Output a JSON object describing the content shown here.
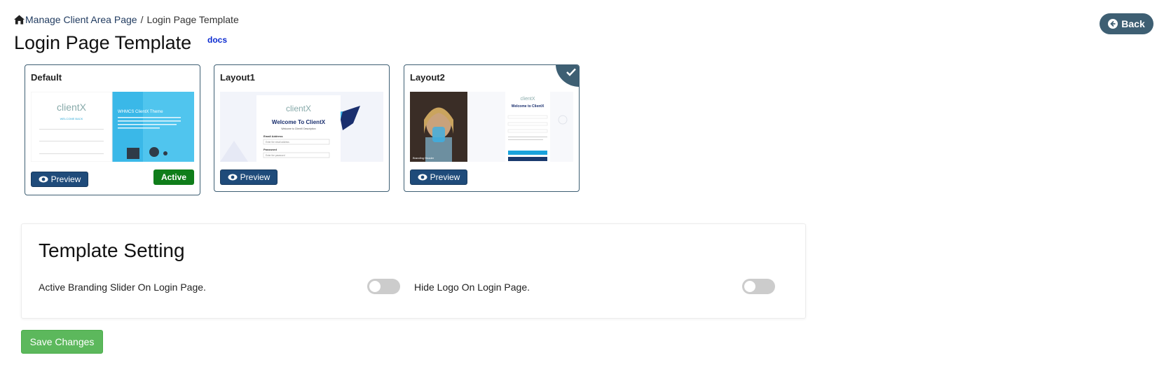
{
  "breadcrumb": {
    "parent": "Manage Client Area Page",
    "separator": "/",
    "current": "Login Page Template"
  },
  "page": {
    "title": "Login Page Template",
    "docs_label": "docs",
    "back_label": "Back"
  },
  "templates": [
    {
      "name": "Default",
      "preview_label": "Preview",
      "badge": "Active",
      "thumb": {
        "logo": "clientX",
        "welcome": "WELCOME BACK",
        "theme_title": "WHMCS ClientX Theme"
      }
    },
    {
      "name": "Layout1",
      "preview_label": "Preview",
      "thumb": {
        "logo": "clientX",
        "welcome": "Welcome To ClientX",
        "subtitle": "Welcome to ClientX Description",
        "email_label": "Email Address",
        "email_placeholder": "Enter the email address",
        "password_label": "Password",
        "password_placeholder": "Enter the password"
      }
    },
    {
      "name": "Layout2",
      "preview_label": "Preview",
      "selected": true,
      "thumb": {
        "logo": "clientX",
        "welcome": "Welcome to ClientX",
        "caption": "Branding Header"
      }
    }
  ],
  "settings": {
    "title": "Template Setting",
    "branding_slider_label": "Active Branding Slider On Login Page.",
    "branding_slider_on": false,
    "hide_logo_label": "Hide Logo On Login Page.",
    "hide_logo_on": false
  },
  "save_label": "Save Changes",
  "colors": {
    "primary": "#1f4b7a",
    "accent": "#3e5f73",
    "success": "#0f7d1a",
    "save": "#5cb85c"
  }
}
